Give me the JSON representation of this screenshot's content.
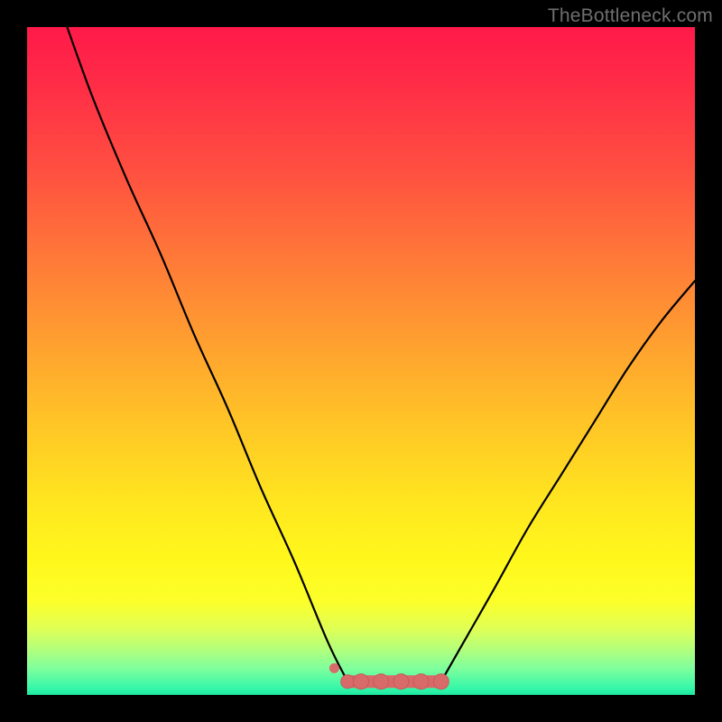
{
  "watermark": "TheBottleneck.com",
  "colors": {
    "background": "#000000",
    "curve": "#000000",
    "marker": "#d96a6a",
    "marker_stroke": "#c85a5a"
  },
  "chart_data": {
    "type": "line",
    "title": "",
    "xlabel": "",
    "ylabel": "",
    "xlim": [
      0,
      100
    ],
    "ylim": [
      0,
      100
    ],
    "grid": false,
    "series": [
      {
        "name": "left-curve",
        "x": [
          6,
          10,
          15,
          20,
          25,
          30,
          35,
          40,
          45,
          48
        ],
        "y": [
          100,
          89,
          77,
          66,
          54,
          43,
          31,
          20,
          8,
          2
        ]
      },
      {
        "name": "right-curve",
        "x": [
          62,
          66,
          70,
          75,
          80,
          85,
          90,
          95,
          100
        ],
        "y": [
          2,
          9,
          16,
          25,
          33,
          41,
          49,
          56,
          62
        ]
      },
      {
        "name": "plateau",
        "x": [
          48,
          50,
          53,
          56,
          59,
          62
        ],
        "y": [
          2,
          2,
          2,
          2,
          2,
          2
        ]
      }
    ],
    "markers": {
      "x": [
        48,
        50,
        53,
        56,
        59,
        62
      ],
      "y": [
        2,
        2,
        2,
        2,
        2,
        2
      ]
    }
  }
}
